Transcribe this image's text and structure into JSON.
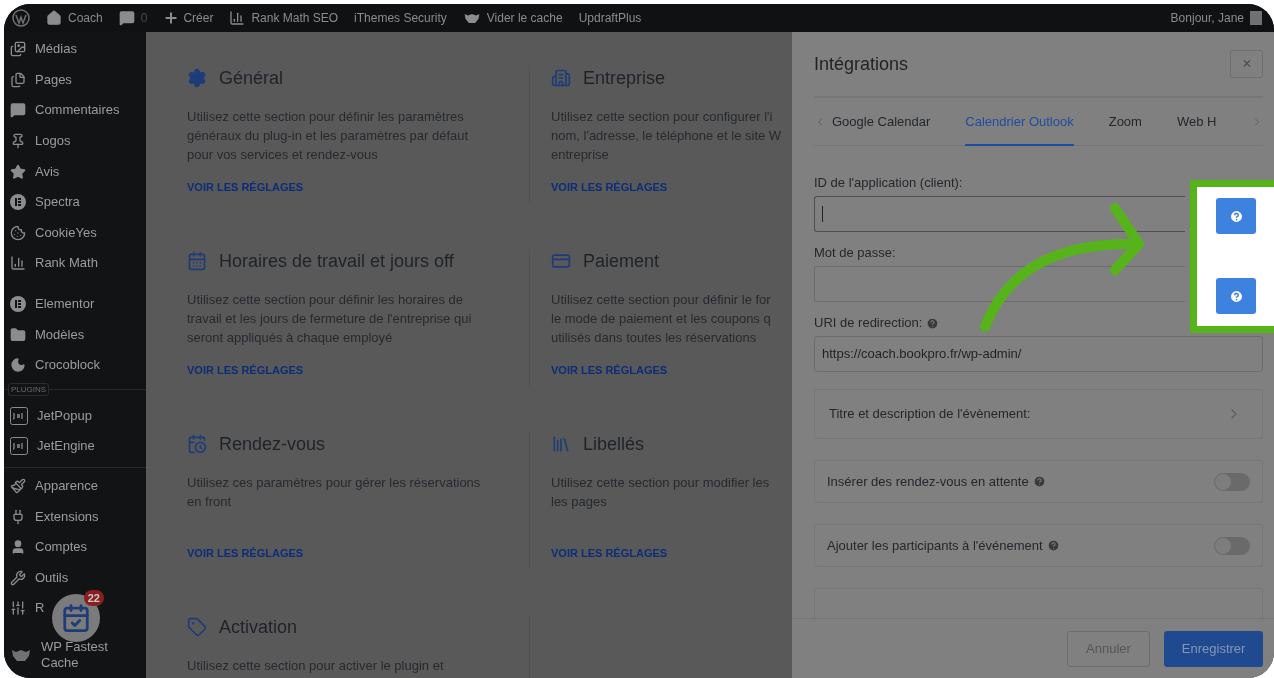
{
  "admin_bar": {
    "site": "Coach",
    "comments": "0",
    "create": "Créer",
    "items": [
      "Rank Math SEO",
      "iThemes Security",
      "Vider le cache",
      "UpdraftPlus"
    ],
    "greeting": "Bonjour, Jane"
  },
  "sidebar": {
    "groups": [
      {
        "items": [
          "Médias",
          "Pages",
          "Commentaires",
          "Logos",
          "Avis",
          "Spectra",
          "CookieYes",
          "Rank Math"
        ]
      },
      {
        "items": [
          "Elementor",
          "Modèles",
          "Crocoblock"
        ]
      },
      {
        "label": "PLUGINS",
        "items": [
          "JetPopup",
          "JetEngine"
        ]
      },
      {
        "items": [
          "Apparence",
          "Extensions",
          "Comptes",
          "Outils",
          "R",
          "WP Fastest Cache"
        ]
      }
    ]
  },
  "notification": {
    "count": "22"
  },
  "sections": [
    {
      "title": "Général",
      "description": [
        "Utilisez cette section pour définir les paramètres",
        "généraux du plug-in et les paramètres par défaut",
        "pour vos services et rendez-vous"
      ],
      "link": "VOIR LES RÉGLAGES"
    },
    {
      "title": "Entreprise",
      "description": [
        "Utilisez cette section pour configurer l'i",
        "nom, l'adresse, le téléphone et le site W",
        "entreprise"
      ],
      "link": "VOIR LES RÉGLAGES"
    },
    {
      "title": "Horaires de travail et jours off",
      "description": [
        "Utilisez cette section pour définir les horaires de",
        "travail et les jours de fermeture de l'entreprise qui",
        "seront appliqués à chaque employé"
      ],
      "link": "VOIR LES RÉGLAGES"
    },
    {
      "title": "Paiement",
      "description": [
        "Utilisez cette section pour définir le for",
        "le mode de paiement et les coupons q",
        "utilisés dans toutes les réservations"
      ],
      "link": "VOIR LES RÉGLAGES"
    },
    {
      "title": "Rendez-vous",
      "description": [
        "Utilisez ces paramètres pour gérer les réservations",
        "en front"
      ],
      "link": "VOIR LES RÉGLAGES"
    },
    {
      "title": "Libellés",
      "description": [
        "Utilisez cette section pour modifier les",
        "les pages"
      ],
      "link": "VOIR LES RÉGLAGES"
    },
    {
      "title": "Activation",
      "description": [
        "Utilisez cette section pour activer le plugin et"
      ]
    }
  ],
  "panel": {
    "title": "Intégrations",
    "close": "×",
    "tabs": [
      {
        "label": "Google Calendar",
        "selected": false
      },
      {
        "label": "Calendrier Outlook",
        "selected": true
      },
      {
        "label": "Zoom",
        "selected": false
      },
      {
        "label": "Web H",
        "selected": false
      }
    ],
    "fields": [
      {
        "label": "ID de l'application (client):",
        "focused": true
      },
      {
        "label": "Mot de passe:",
        "focused": false
      },
      {
        "label": "URI de redirection:",
        "help": true,
        "value": "https://coach.bookpro.fr/wp-admin/",
        "focused": false
      }
    ],
    "accordion": "Titre et description de l'évènement:",
    "toggles": [
      {
        "label": "Insérer des rendez-vous en attente",
        "on": false
      },
      {
        "label": "Ajouter les participants à l'événement",
        "on": false
      }
    ],
    "buttons": {
      "cancel": "Annuler",
      "save": "Enregistrer"
    }
  }
}
